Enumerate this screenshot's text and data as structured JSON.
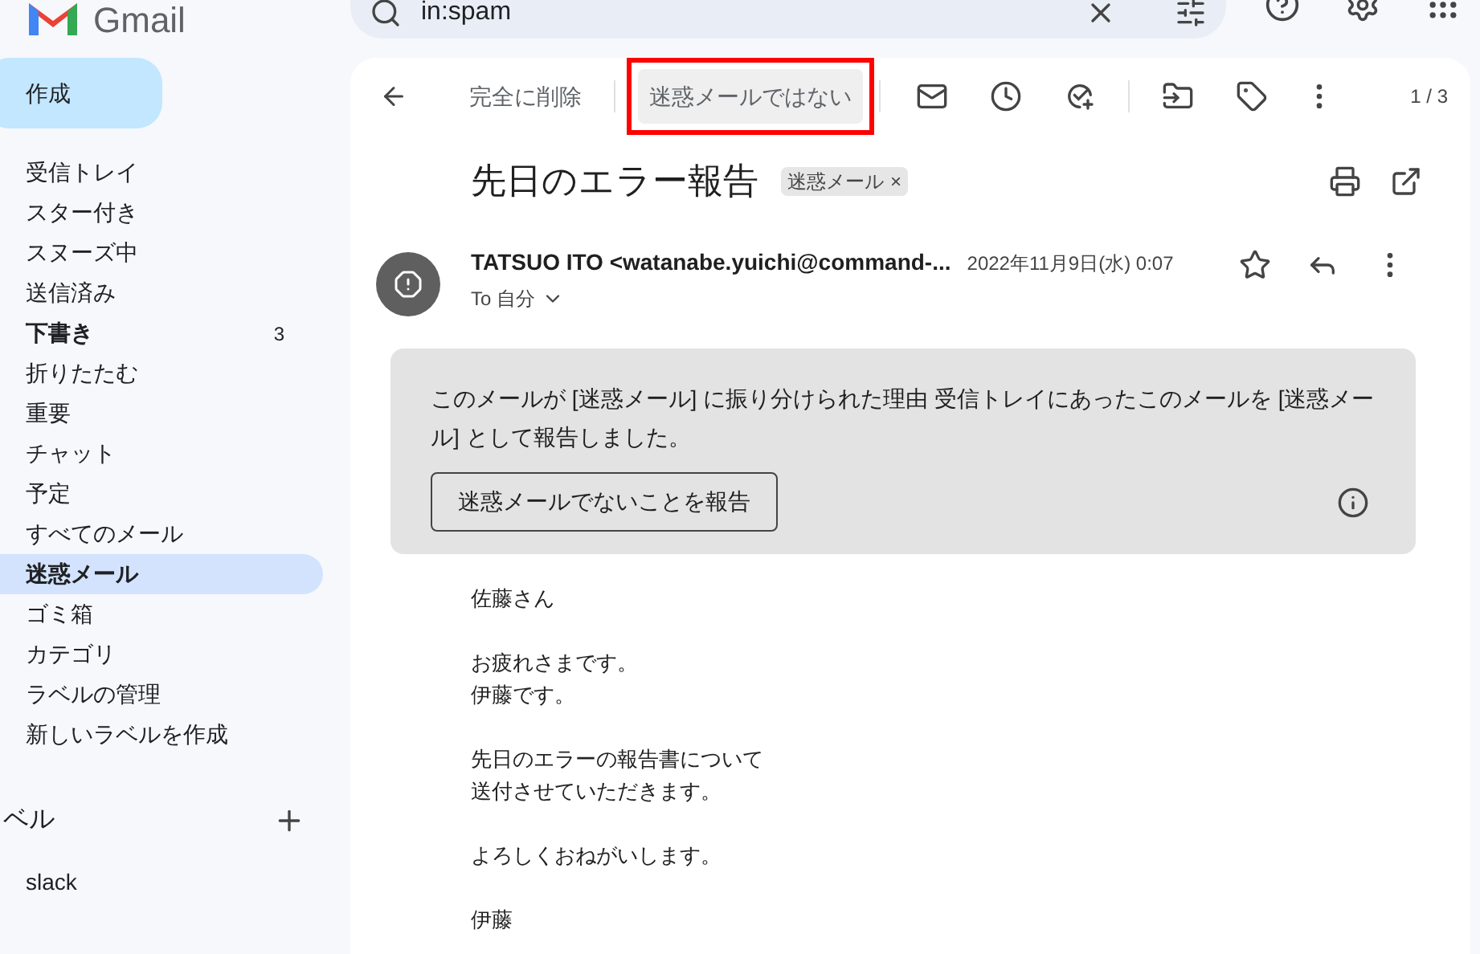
{
  "app": {
    "name": "Gmail"
  },
  "search": {
    "value": "in:spam"
  },
  "compose": {
    "label": "作成"
  },
  "sidebar": {
    "items": [
      {
        "label": "受信トレイ",
        "selected": false,
        "bold": false
      },
      {
        "label": "スター付き",
        "selected": false,
        "bold": false
      },
      {
        "label": "スヌーズ中",
        "selected": false,
        "bold": false
      },
      {
        "label": "送信済み",
        "selected": false,
        "bold": false
      },
      {
        "label": "下書き",
        "selected": false,
        "bold": true,
        "count": "3"
      },
      {
        "label": "折りたたむ",
        "selected": false,
        "bold": false
      },
      {
        "label": "重要",
        "selected": false,
        "bold": false
      },
      {
        "label": "チャット",
        "selected": false,
        "bold": false
      },
      {
        "label": "予定",
        "selected": false,
        "bold": false
      },
      {
        "label": "すべてのメール",
        "selected": false,
        "bold": false
      },
      {
        "label": "迷惑メール",
        "selected": true,
        "bold": true
      },
      {
        "label": "ゴミ箱",
        "selected": false,
        "bold": false
      },
      {
        "label": "カテゴリ",
        "selected": false,
        "bold": false
      },
      {
        "label": "ラベルの管理",
        "selected": false,
        "bold": false
      },
      {
        "label": "新しいラベルを作成",
        "selected": false,
        "bold": false
      }
    ],
    "labels_heading": "ベル",
    "labels": [
      {
        "label": "slack",
        "selected": false
      }
    ]
  },
  "toolbar": {
    "delete_forever": "完全に削除",
    "not_spam": {
      "label": "迷惑メールではない",
      "highlighted": true
    },
    "pager": "1 / 3"
  },
  "message": {
    "subject": "先日のエラー報告",
    "tag": "迷惑メール",
    "tag_close": "×",
    "sender": "TATSUO ITO <watanabe.yuichi@command-...",
    "date": "2022年11月9日(水) 0:07",
    "to": "To 自分",
    "starred": false,
    "spam_notice": {
      "text": "このメールが [迷惑メール] に振り分けられた理由 受信トレイにあったこのメールを [迷惑メール] として報告しました。",
      "button": "迷惑メールでないことを報告"
    },
    "body": [
      [
        "佐藤さん"
      ],
      [
        "お疲れさまです。",
        "伊藤です。"
      ],
      [
        "先日のエラーの報告書について",
        "送付させていただきます。"
      ],
      [
        "よろしくおねがいします。"
      ],
      [
        "伊藤"
      ]
    ]
  }
}
